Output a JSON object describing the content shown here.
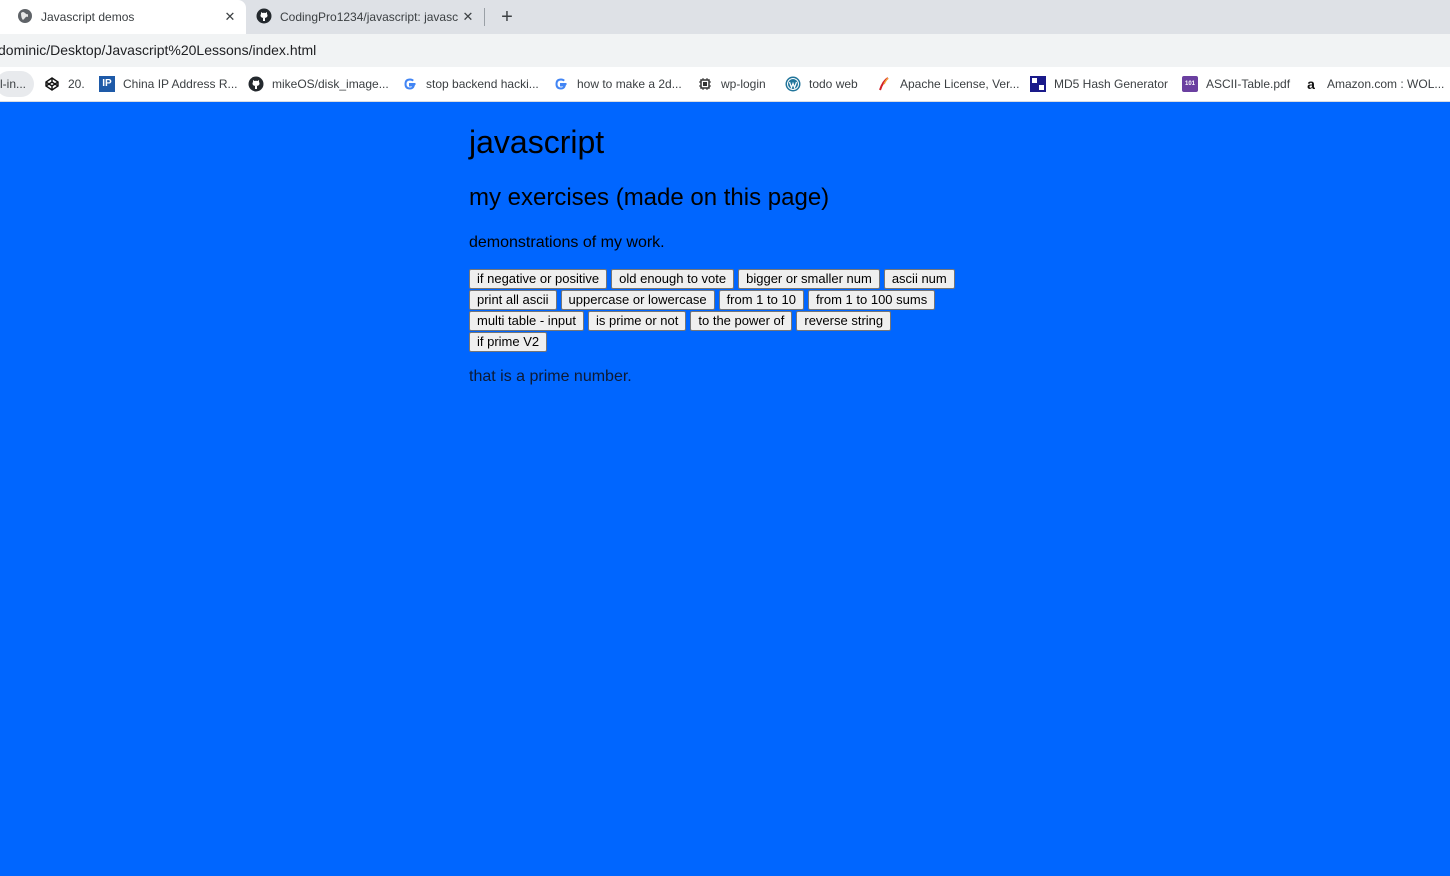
{
  "browser": {
    "tabs": [
      {
        "title": "Javascript demos",
        "icon": "globe-icon",
        "active": true
      },
      {
        "title": "CodingPro1234/javascript: javasc",
        "icon": "github-icon",
        "active": false
      }
    ],
    "new_tab_symbol": "+",
    "close_symbol": "✕",
    "address": "dominic/Desktop/Javascript%20Lessons/index.html",
    "bookmarks": [
      {
        "label": "l-in...",
        "icon": ""
      },
      {
        "label": "20.",
        "icon": "codepen-icon"
      },
      {
        "label": "China IP Address R...",
        "icon": "ip-icon"
      },
      {
        "label": "mikeOS/disk_image...",
        "icon": "github-icon"
      },
      {
        "label": "stop backend hacki...",
        "icon": "google-icon"
      },
      {
        "label": "how to make a 2d...",
        "icon": "google-icon"
      },
      {
        "label": "wp-login",
        "icon": "chip-icon"
      },
      {
        "label": "todo web",
        "icon": "wordpress-icon"
      },
      {
        "label": "Apache License, Ver...",
        "icon": "feather-icon"
      },
      {
        "label": "MD5 Hash Generator",
        "icon": "code-beautify-icon"
      },
      {
        "label": "ASCII-Table.pdf",
        "icon": "pdf-101-icon"
      },
      {
        "label": "Amazon.com : WOL...",
        "icon": "amazon-icon"
      }
    ]
  },
  "page": {
    "title": "javascript",
    "section_heading": "my exercises (made on this page)",
    "subheading": "demonstrations of my work.",
    "button_rows": [
      [
        "if negative or positive",
        "old enough to vote",
        "bigger or smaller num",
        "ascii num"
      ],
      [
        "print all ascii",
        "uppercase or lowercase",
        "from 1 to 10",
        "from 1 to 100 sums"
      ],
      [
        "multi table - input",
        "is prime or not",
        "to the power of",
        "reverse string"
      ],
      [
        "if prime V2"
      ]
    ],
    "result": "that is a prime number."
  },
  "colors": {
    "page_background": "#0066ff",
    "tabstrip": "#dee1e6",
    "addressbar": "#f1f3f4"
  }
}
